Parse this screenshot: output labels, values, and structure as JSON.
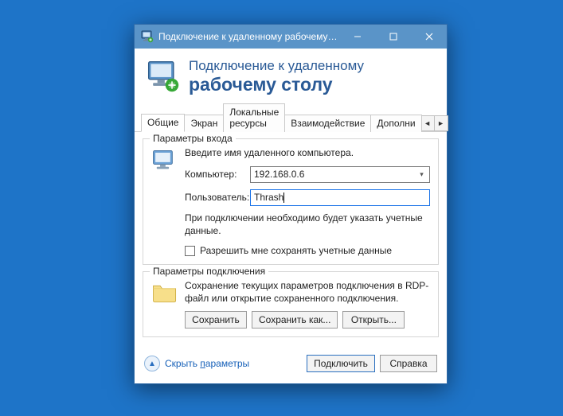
{
  "titlebar": {
    "title": "Подключение к удаленному рабочему с..."
  },
  "header": {
    "line1": "Подключение к удаленному",
    "line2": "рабочему столу"
  },
  "tabs": {
    "items": [
      {
        "label": "Общие"
      },
      {
        "label": "Экран"
      },
      {
        "label": "Локальные ресурсы"
      },
      {
        "label": "Взаимодействие"
      },
      {
        "label": "Дополни"
      }
    ]
  },
  "login": {
    "legend": "Параметры входа",
    "instruction": "Введите имя удаленного компьютера.",
    "computer_label": "Компьютер:",
    "computer_value": "192.168.0.6",
    "user_label": "Пользователь:",
    "user_value": "Thrash",
    "note": "При подключении необходимо будет указать учетные данные.",
    "checkbox_label": "Разрешить мне сохранять учетные данные"
  },
  "connection": {
    "legend": "Параметры подключения",
    "text": "Сохранение текущих параметров подключения в RDP-файл или открытие сохраненного подключения.",
    "save": "Сохранить",
    "save_as": "Сохранить как...",
    "open": "Открыть..."
  },
  "footer": {
    "hide_prefix": "Скрыть ",
    "hide_underlined": "п",
    "hide_suffix": "араметры",
    "connect": "Подключить",
    "help": "Справка"
  }
}
